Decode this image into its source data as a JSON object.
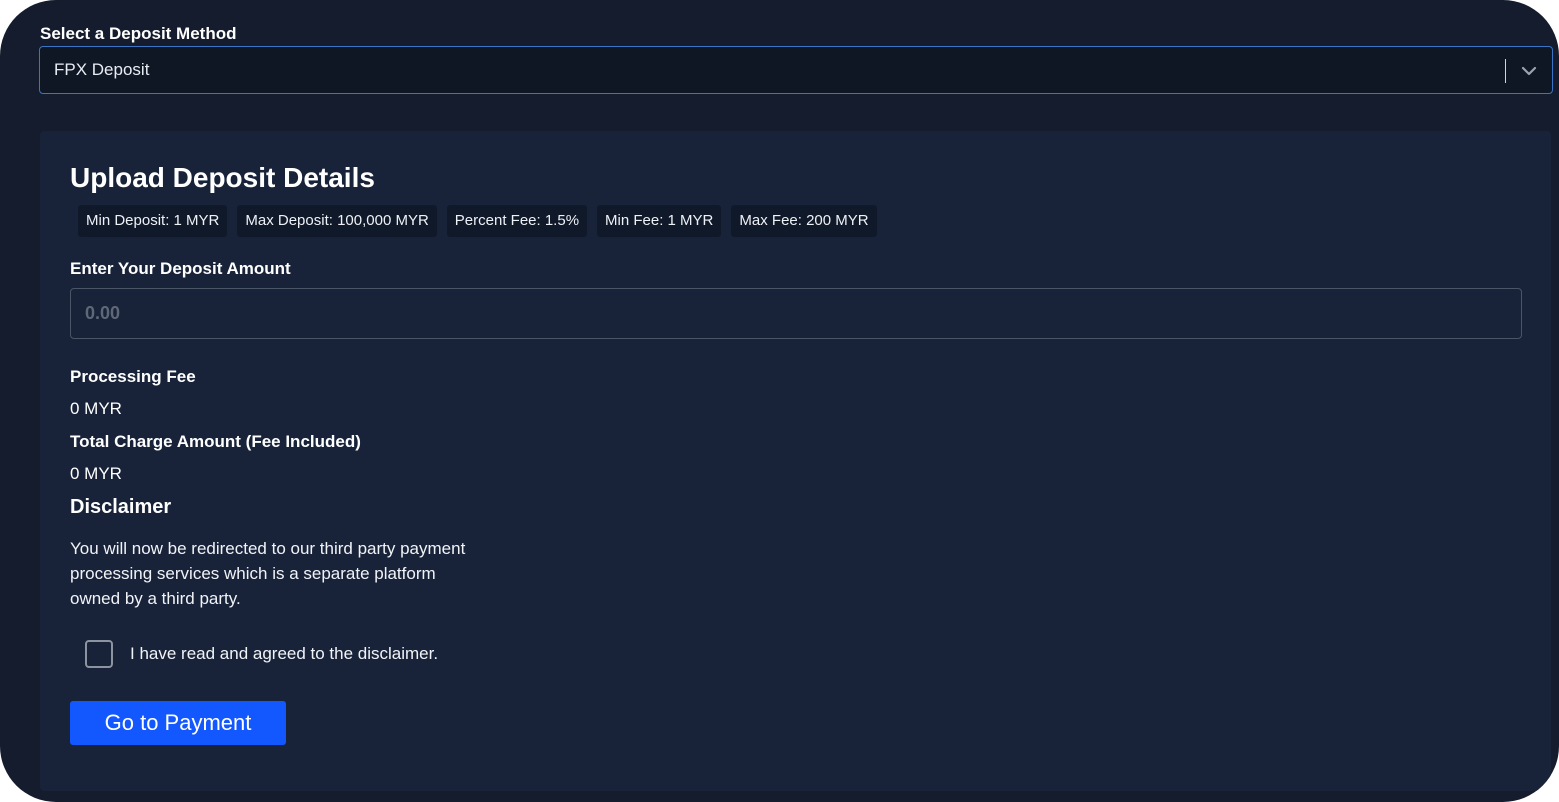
{
  "deposit_method": {
    "label": "Select a Deposit Method",
    "selected_value": "FPX Deposit",
    "dropdown_icon": "chevron-down-icon"
  },
  "panel": {
    "title": "Upload Deposit Details",
    "limits": [
      "Min Deposit: 1 MYR",
      "Max Deposit: 100,000 MYR",
      "Percent Fee: 1.5%",
      "Min Fee: 1 MYR",
      "Max Fee: 200 MYR"
    ],
    "amount": {
      "label": "Enter Your Deposit Amount",
      "placeholder": "0.00",
      "value": ""
    },
    "processing_fee": {
      "label": "Processing Fee",
      "value": "0 MYR"
    },
    "total_charge": {
      "label": "Total Charge Amount (Fee Included)",
      "value": "0 MYR"
    },
    "disclaimer": {
      "title": "Disclaimer",
      "text": "You will now be redirected to our third party payment processing services which is a separate platform owned by a third party.",
      "agree_label": "I have read and agreed to the disclaimer.",
      "agreed": false
    },
    "submit_label": "Go to Payment"
  },
  "colors": {
    "background": "#141c2d",
    "panel": "#18233a",
    "accent": "#1358ff",
    "focus_border": "#3a74c4"
  }
}
